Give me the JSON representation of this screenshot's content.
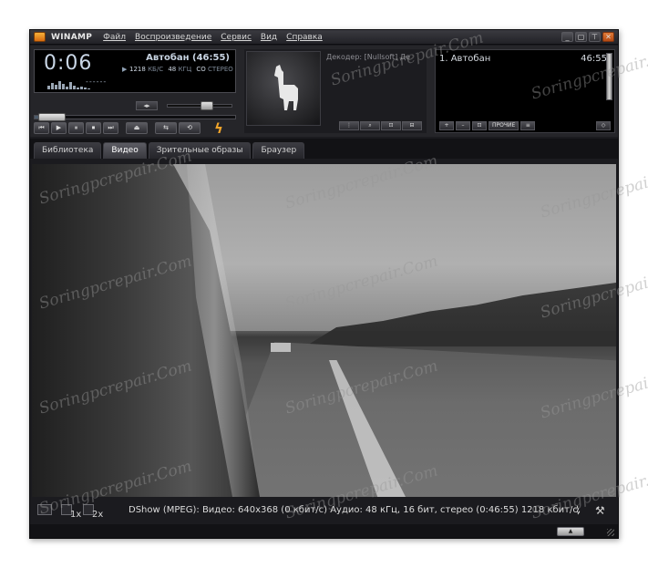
{
  "app": {
    "name": "WINAMP",
    "menu": [
      "Файл",
      "Воспроизведение",
      "Сервис",
      "Вид",
      "Справка"
    ],
    "window_buttons": [
      "_",
      "▢",
      "⊤",
      "✕"
    ]
  },
  "player": {
    "time": "0:06",
    "track_title": "Автобан (46:55)",
    "bitrate": "1218",
    "bitrate_unit": "КБ/С",
    "sample_rate": "48",
    "sample_unit": "КГЦ",
    "channels_icon": "CO",
    "channels": "СТЕРЕО",
    "dashes": "------",
    "volume_level": 0.62,
    "seek_position": 0.02,
    "controls": [
      "⏮",
      "▶",
      "⏸",
      "⏹",
      "⏭"
    ],
    "eject": "⏏",
    "shuffle": "⇆",
    "repeat": "⟲"
  },
  "art": {
    "decoder": "Декодер: [Nullsoft] Де",
    "buttons": [
      "⋮",
      "⌕",
      "⊡",
      "⊟"
    ]
  },
  "playlist": {
    "items": [
      {
        "label": "1. Автобан",
        "duration": "46:55"
      }
    ],
    "buttons": [
      "+",
      "–",
      "⊡",
      "ПРОЧИЕ",
      "≡"
    ],
    "right_button": "◇"
  },
  "tabs": [
    "Библиотека",
    "Видео",
    "Зрительные образы",
    "Браузер"
  ],
  "active_tab": 1,
  "video_status": {
    "text": "DShow (MPEG): Видео: 640x368 (0 кбит/с) Аудио: 48 кГц, 16 бит, стерео (0:46:55) 1218 кбит/с,",
    "zoom_1x": "1x",
    "zoom_2x": "2x"
  },
  "bottom": {
    "button": "▲"
  },
  "watermark": "Soringpcrepair.Com"
}
